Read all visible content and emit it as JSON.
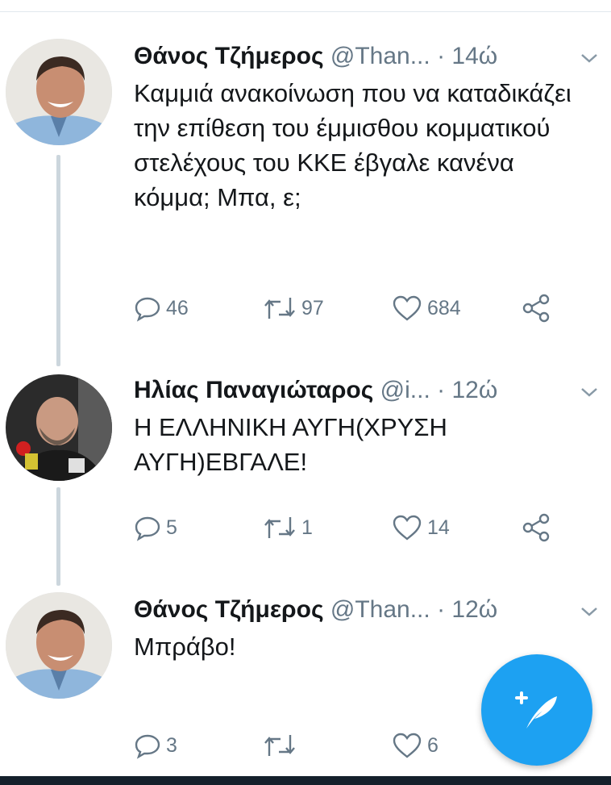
{
  "colors": {
    "accent": "#1da1f2",
    "thread_line": "#ccd6dd",
    "secondary_text": "#657786"
  },
  "tweets": [
    {
      "name": "Θάνος Τζήμερος",
      "handle": "@Than...",
      "time": "· 14ώ",
      "text": "Καμμιά ανακοίνωση που να καταδικάζει την επίθεση του έμμισθου κομματικού στελέχους του ΚΚΕ έβγαλε κανένα κόμμα; Μπα, ε;",
      "replies": "46",
      "retweets": "97",
      "likes": "684"
    },
    {
      "name": "Ηλίας Παναγιώταρος",
      "handle": "@i...",
      "time": "· 12ώ",
      "text": "Η ΕΛΛΗΝΙΚΗ ΑΥΓΗ(ΧΡΥΣΗ ΑΥΓΗ)ΕΒΓΑΛΕ!",
      "replies": "5",
      "retweets": "1",
      "likes": "14"
    },
    {
      "name": "Θάνος Τζήμερος",
      "handle": "@Than...",
      "time": "· 12ώ",
      "text": "Μπράβο!",
      "replies": "3",
      "retweets": "",
      "likes": "6"
    }
  ],
  "icons": {
    "reply": "reply-icon",
    "retweet": "retweet-icon",
    "like": "heart-icon",
    "share": "share-icon",
    "compose": "compose-tweet-icon",
    "caret": "chevron-down-icon"
  }
}
